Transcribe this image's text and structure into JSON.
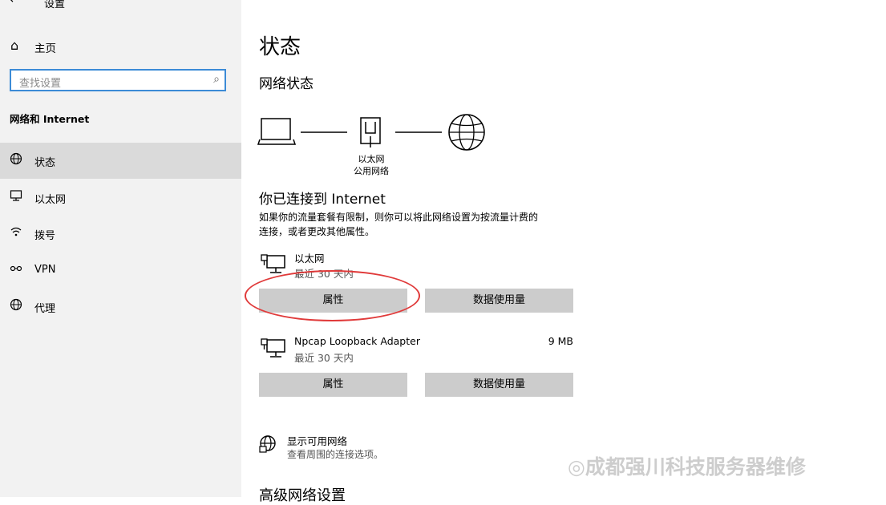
{
  "window": {
    "title": "设置",
    "back_icon": "←"
  },
  "sidebar": {
    "home": {
      "label": "主页",
      "icon": "⌂"
    },
    "search": {
      "placeholder": "查找设置",
      "icon": "⌕"
    },
    "section_title": "网络和 Internet",
    "items": [
      {
        "label": "状态",
        "icon": "globe-icon",
        "active": true
      },
      {
        "label": "以太网",
        "icon": "monitor-icon"
      },
      {
        "label": "拨号",
        "icon": "dialup-icon"
      },
      {
        "label": "VPN",
        "icon": "vpn-icon"
      },
      {
        "label": "代理",
        "icon": "globe-icon"
      }
    ]
  },
  "main": {
    "title": "状态",
    "network_status_title": "网络状态",
    "diagram": {
      "adapter_name": "以太网",
      "adapter_type": "公用网络"
    },
    "connected_title": "你已连接到 Internet",
    "description_line1": "如果你的流量套餐有限制，则你可以将此网络设置为按流量计费的",
    "description_line2": "连接，或者更改其他属性。",
    "adapters": [
      {
        "name": "以太网",
        "period": "最近 30 天内",
        "usage": "",
        "properties_label": "属性",
        "data_usage_label": "数据使用量"
      },
      {
        "name": "Npcap Loopback Adapter",
        "period": "最近 30 天内",
        "usage": "9 MB",
        "properties_label": "属性",
        "data_usage_label": "数据使用量"
      }
    ],
    "show_networks": {
      "title": "显示可用网络",
      "subtitle": "查看周围的连接选项。"
    },
    "advanced_title": "高级网络设置"
  },
  "watermark": "◎成都强川科技服务器维修",
  "colors": {
    "sidebar_bg": "#f2f2f2",
    "active_item_bg": "#dadada",
    "search_border": "#3c8bd6",
    "button_bg": "#cccccc",
    "annotation": "#e03a3a"
  }
}
